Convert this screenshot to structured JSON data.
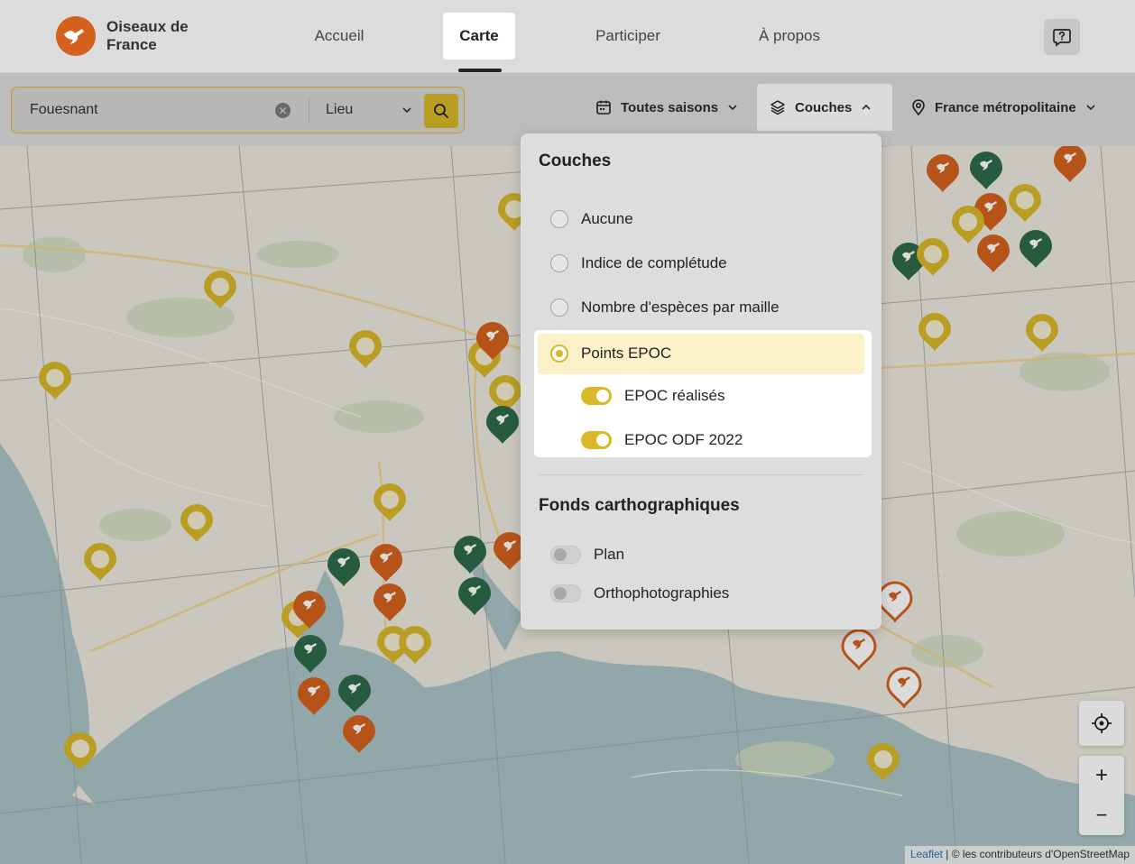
{
  "brand": {
    "name": "Oiseaux de France"
  },
  "nav": {
    "items": [
      {
        "label": "Accueil",
        "active": false
      },
      {
        "label": "Carte",
        "active": true
      },
      {
        "label": "Participer",
        "active": false
      },
      {
        "label": "À propos",
        "active": false
      }
    ],
    "help_icon": "help-icon"
  },
  "search": {
    "value": "Fouesnant",
    "type_label": "Lieu",
    "clear_icon": "clear-icon",
    "button_icon": "search-icon"
  },
  "filters": {
    "season_label": "Toutes saisons",
    "layers_label": "Couches",
    "region_label": "France métropolitaine"
  },
  "layers_panel": {
    "title": "Couches",
    "options": [
      {
        "label": "Aucune",
        "checked": false
      },
      {
        "label": "Indice de complétude",
        "checked": false
      },
      {
        "label": "Nombre d'espèces par maille",
        "checked": false
      },
      {
        "label": "Points EPOC",
        "checked": true
      }
    ],
    "sub_options": [
      {
        "label": "EPOC réalisés",
        "on": true
      },
      {
        "label": "EPOC ODF 2022",
        "on": true
      }
    ],
    "basemaps_title": "Fonds carthographiques",
    "basemaps": [
      {
        "label": "Plan",
        "on": false
      },
      {
        "label": "Orthophotographies",
        "on": false
      }
    ]
  },
  "map": {
    "zoom_in": "+",
    "zoom_out": "−",
    "attribution_link": "Leaflet",
    "attribution_text": " | © les contributeurs d'OpenStreetMap"
  },
  "colors": {
    "accent": "#d9b92a",
    "orange_marker": "#d4611e",
    "green_marker": "#2e6a4b",
    "yellow_marker": "#d9b92a"
  }
}
